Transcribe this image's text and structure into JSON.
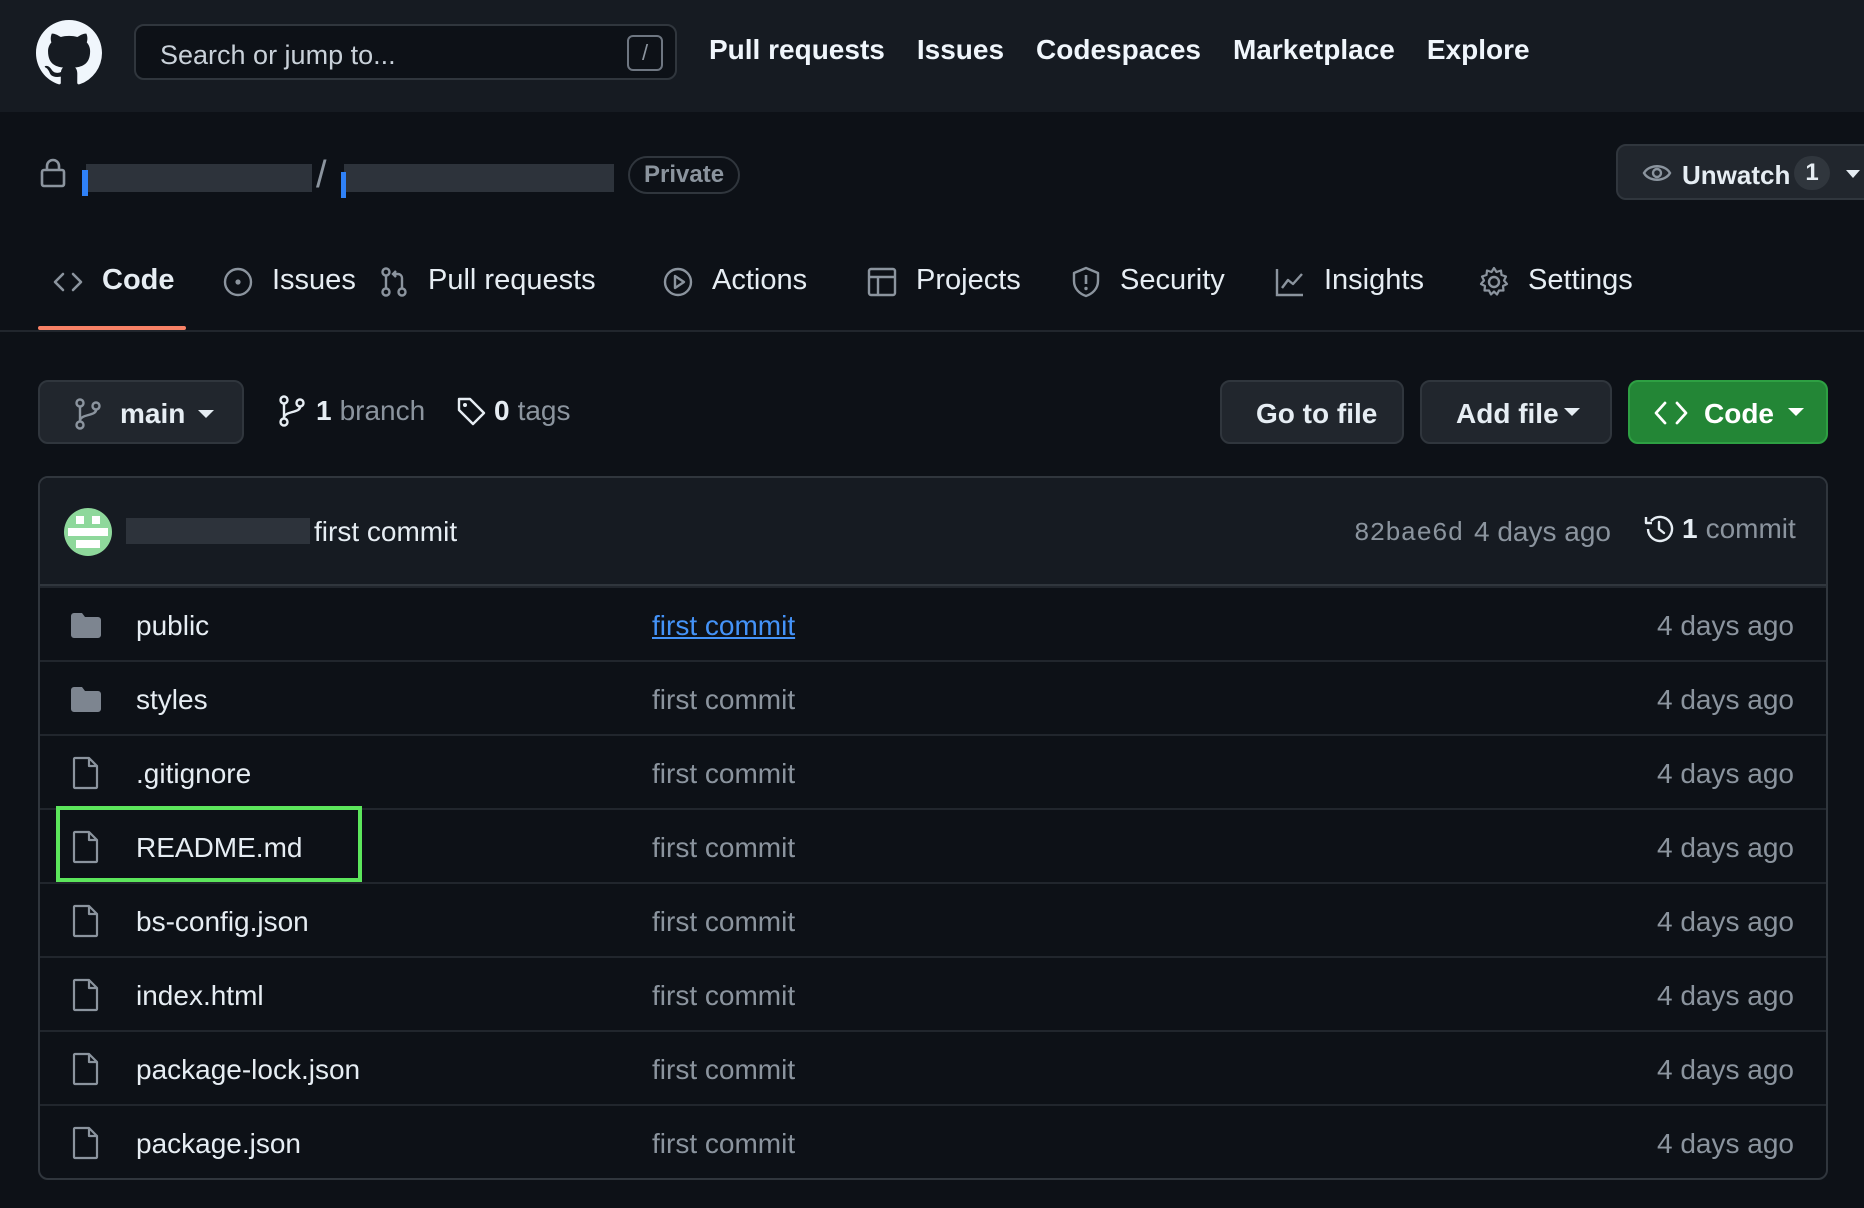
{
  "header": {
    "search_placeholder": "Search or jump to...",
    "search_shortcut": "/",
    "nav": [
      "Pull requests",
      "Issues",
      "Codespaces",
      "Marketplace",
      "Explore"
    ]
  },
  "repo": {
    "separator": "/",
    "visibility": "Private",
    "watch": {
      "label": "Unwatch",
      "count": "1"
    }
  },
  "tabs": [
    {
      "label": "Code",
      "icon": "code-icon",
      "active": true
    },
    {
      "label": "Issues",
      "icon": "issue-opened-icon"
    },
    {
      "label": "Pull requests",
      "icon": "git-pull-request-icon"
    },
    {
      "label": "Actions",
      "icon": "play-icon"
    },
    {
      "label": "Projects",
      "icon": "table-icon"
    },
    {
      "label": "Security",
      "icon": "shield-icon"
    },
    {
      "label": "Insights",
      "icon": "graph-icon"
    },
    {
      "label": "Settings",
      "icon": "gear-icon"
    }
  ],
  "toolbar": {
    "branch": "main",
    "branch_count": "1",
    "branch_text": "branch",
    "tag_count": "0",
    "tag_text": "tags",
    "go_to_file": "Go to file",
    "add_file": "Add file",
    "code": "Code"
  },
  "latest_commit": {
    "message": "first commit",
    "sha": "82bae6d",
    "age": "4 days ago",
    "commit_count": "1",
    "commit_text": "commit"
  },
  "files": [
    {
      "name": "public",
      "type": "folder",
      "commit": "first commit",
      "age": "4 days ago"
    },
    {
      "name": "styles",
      "type": "folder",
      "commit": "first commit",
      "age": "4 days ago"
    },
    {
      "name": ".gitignore",
      "type": "file",
      "commit": "first commit",
      "age": "4 days ago"
    },
    {
      "name": "README.md",
      "type": "file",
      "commit": "first commit",
      "age": "4 days ago"
    },
    {
      "name": "bs-config.json",
      "type": "file",
      "commit": "first commit",
      "age": "4 days ago"
    },
    {
      "name": "index.html",
      "type": "file",
      "commit": "first commit",
      "age": "4 days ago"
    },
    {
      "name": "package-lock.json",
      "type": "file",
      "commit": "first commit",
      "age": "4 days ago"
    },
    {
      "name": "package.json",
      "type": "file",
      "commit": "first commit",
      "age": "4 days ago"
    }
  ],
  "colors": {
    "background": "#0d1117",
    "header": "#161b22",
    "accent_underline": "#f78166",
    "code_button": "#238636",
    "link": "#4493f8",
    "highlight": "#5ce65c"
  }
}
